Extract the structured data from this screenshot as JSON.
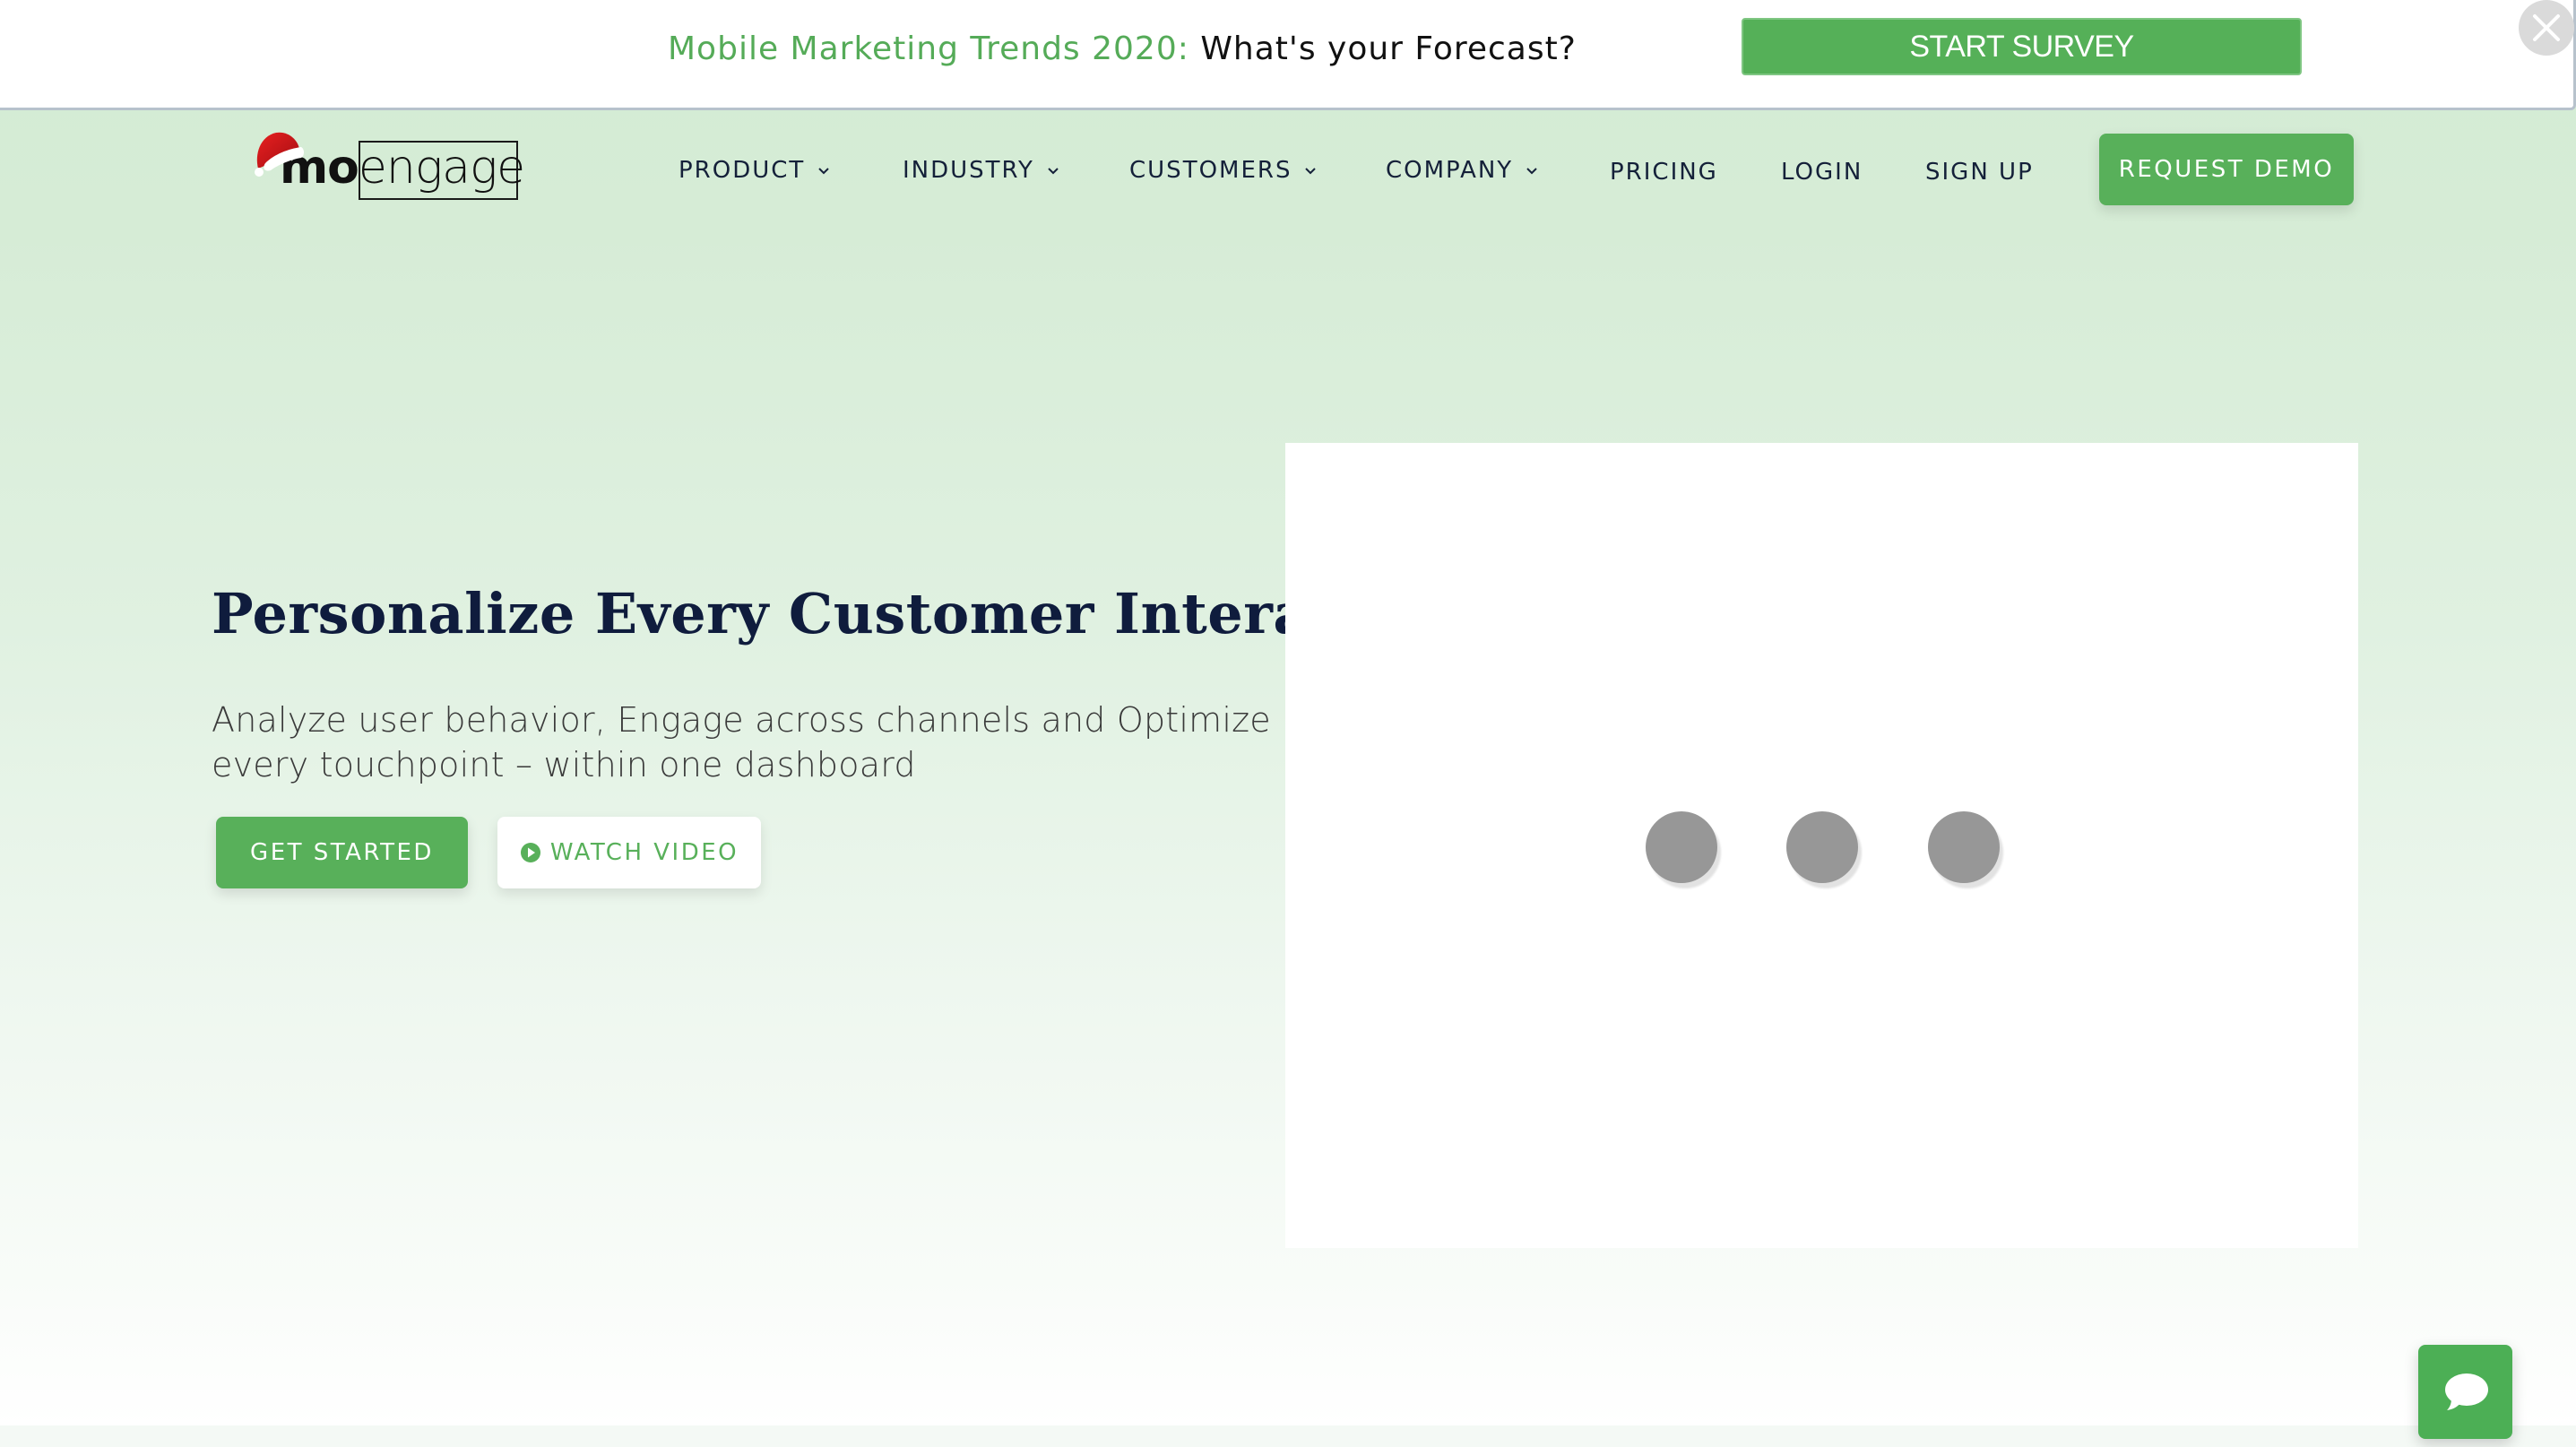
{
  "survey_banner": {
    "highlight": "Mobile Marketing Trends 2020:",
    "question": "What's your Forecast?",
    "button_label": "START SURVEY",
    "close_icon": "close-icon"
  },
  "brand": {
    "logo_text_bold": "mo",
    "logo_text_light": "engage",
    "logo_decoration": "santa-hat-icon",
    "accent_color": "#58b05a",
    "text_color": "#142039"
  },
  "nav": {
    "items": [
      {
        "label": "PRODUCT",
        "has_dropdown": true
      },
      {
        "label": "INDUSTRY",
        "has_dropdown": true
      },
      {
        "label": "CUSTOMERS",
        "has_dropdown": true
      },
      {
        "label": "COMPANY",
        "has_dropdown": true
      },
      {
        "label": "PRICING",
        "has_dropdown": false
      },
      {
        "label": "LOGIN",
        "has_dropdown": false
      },
      {
        "label": "SIGN UP",
        "has_dropdown": false
      }
    ],
    "cta_label": "REQUEST DEMO"
  },
  "hero": {
    "title": "Personalize Every Customer Interaction",
    "subtitle": "Analyze user behavior, Engage across channels and Optimize every touchpoint – within one dashboard",
    "primary_button": "GET STARTED",
    "secondary_button": "WATCH VIDEO",
    "secondary_icon": "play-circle-icon"
  },
  "media": {
    "state": "loading",
    "loader_dots": 3
  },
  "chat": {
    "icon": "chat-bubble-icon"
  }
}
